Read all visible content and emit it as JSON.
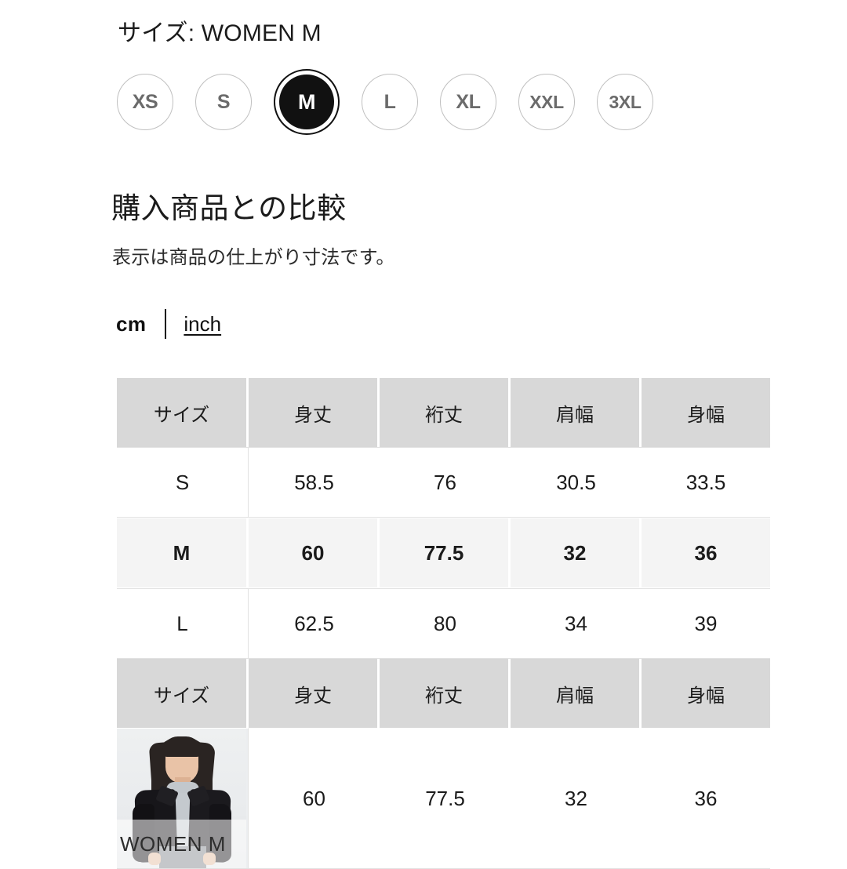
{
  "size_label": "サイズ: WOMEN M",
  "size_chips": {
    "options": [
      {
        "label": "XS",
        "selected": false
      },
      {
        "label": "S",
        "selected": false
      },
      {
        "label": "M",
        "selected": true
      },
      {
        "label": "L",
        "selected": false
      },
      {
        "label": "XL",
        "selected": false
      },
      {
        "label": "XXL",
        "selected": false
      },
      {
        "label": "3XL",
        "selected": false
      }
    ],
    "selected_value": "M"
  },
  "compare": {
    "title": "購入商品との比較",
    "subtitle": "表示は商品の仕上がり寸法です。"
  },
  "unit_toggle": {
    "active": "cm",
    "inactive": "inch",
    "selected": "cm"
  },
  "table": {
    "headers": [
      "サイズ",
      "身丈",
      "裄丈",
      "肩幅",
      "身幅"
    ],
    "rows": [
      {
        "size": "S",
        "values": [
          "58.5",
          "76",
          "30.5",
          "33.5"
        ],
        "highlight": false
      },
      {
        "size": "M",
        "values": [
          "60",
          "77.5",
          "32",
          "36"
        ],
        "highlight": true
      },
      {
        "size": "L",
        "values": [
          "62.5",
          "80",
          "34",
          "39"
        ],
        "highlight": false
      }
    ],
    "headers2": [
      "サイズ",
      "身丈",
      "裄丈",
      "肩幅",
      "身幅"
    ],
    "purchased_row": {
      "image_caption": "WOMEN M",
      "values": [
        "60",
        "77.5",
        "32",
        "36"
      ]
    }
  },
  "colors": {
    "header_bg": "#d8d8d8",
    "highlight_bg": "#f4f4f4",
    "text": "#1b1b1b",
    "chip_border": "#c0c0c0",
    "chip_text": "#6b6b6b",
    "selected_bg": "#111111"
  }
}
